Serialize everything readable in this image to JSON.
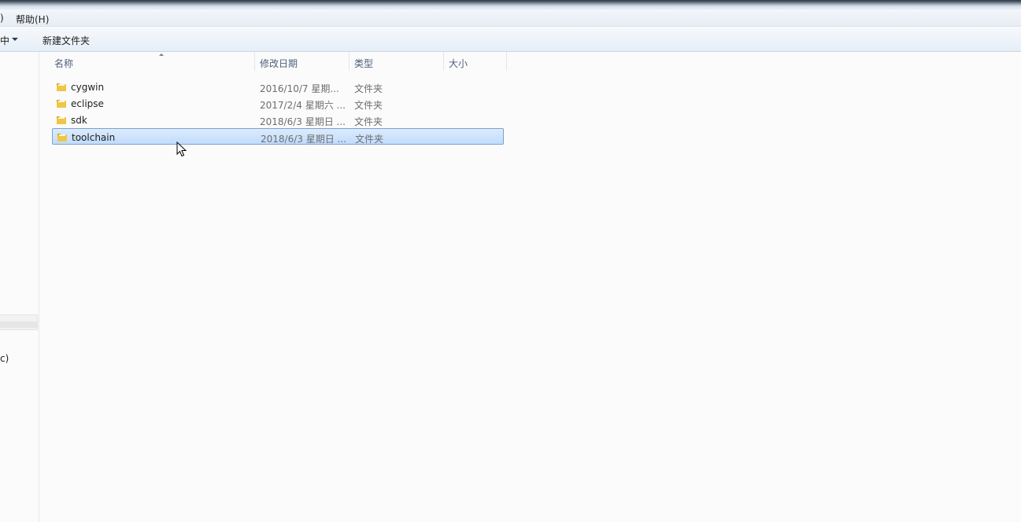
{
  "menubar": {
    "partial_item": ")",
    "help_label": "帮助(H)"
  },
  "toolbar": {
    "partial_label": "中",
    "new_folder_label": "新建文件夹"
  },
  "navpane": {
    "partial_label": "c)"
  },
  "columns": [
    {
      "label": "名称"
    },
    {
      "label": "修改日期"
    },
    {
      "label": "类型"
    },
    {
      "label": "大小"
    }
  ],
  "files": [
    {
      "name": "cygwin",
      "modified": "2016/10/7 星期...",
      "type": "文件夹",
      "selected": false
    },
    {
      "name": "eclipse",
      "modified": "2017/2/4 星期六 ...",
      "type": "文件夹",
      "selected": false
    },
    {
      "name": "sdk",
      "modified": "2018/6/3 星期日 ...",
      "type": "文件夹",
      "selected": false
    },
    {
      "name": "toolchain",
      "modified": "2018/6/3 星期日 ...",
      "type": "文件夹",
      "selected": true
    }
  ],
  "icons": {
    "folder": "folder-icon",
    "cursor": "mouse-cursor-icon",
    "sort": "sort-ascending-icon",
    "dropdown": "chevron-down-icon"
  },
  "colors": {
    "selection_fill": "#c9e0fc",
    "selection_border": "#7da2ce",
    "header_text": "#4c607a"
  }
}
